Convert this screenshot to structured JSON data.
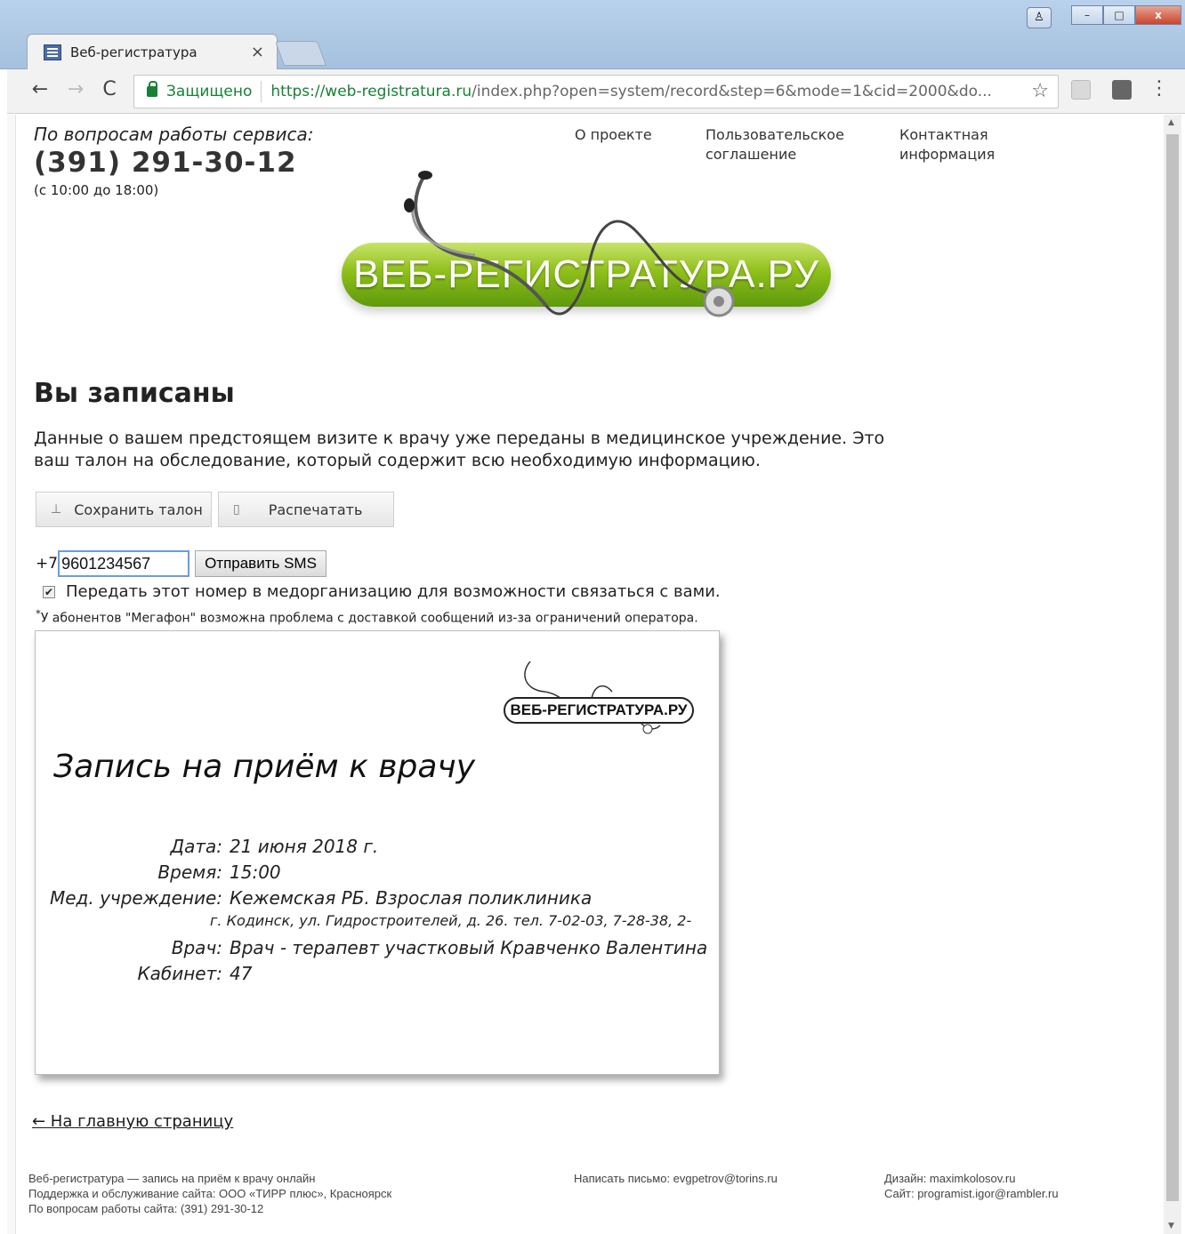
{
  "browser": {
    "tab_title": "Веб-регистратура",
    "tab_close": "×",
    "secure_label": "Защищено",
    "url_scheme_host": "https://web-registratura.ru",
    "url_rest": "/index.php?open=system/record&step=6&mode=1&cid=2000&do...",
    "back": "←",
    "forward": "→",
    "reload": "C",
    "star": "☆",
    "menu": "⋮",
    "win_min": "–",
    "win_max": "□",
    "win_close": "x",
    "user": "♙"
  },
  "support": {
    "label": "По вопросам работы сервиса:",
    "phone": "(391) 291-30-12",
    "hours": "(с 10:00 до 18:00)"
  },
  "nav": [
    {
      "label": "О проекте"
    },
    {
      "label": "Пользовательское соглашение"
    },
    {
      "label": "Контактная информация"
    }
  ],
  "logo_text": "ВЕБ-РЕГИСТРАТУРА.РУ",
  "heading": "Вы записаны",
  "lead": "Данные о вашем предстоящем визите к врачу уже переданы в медицинское учреждение. Это ваш талон на обследование, который содержит всю необходимую информацию.",
  "buttons": {
    "save": "Сохранить талон",
    "save_icon": "⊥",
    "print": "Распечатать",
    "print_icon": "▯"
  },
  "sms": {
    "prefix": "+7",
    "phone_value": "9601234567",
    "send_label": "Отправить SMS",
    "consent_label": "Передать этот номер в медорганизацию для возможности связаться с вами.",
    "consent_checked": true,
    "note_mark": "*",
    "note": "У абонентов \"Мегафон\" возможна проблема с доставкой сообщений из-за ограничений оператора."
  },
  "ticket": {
    "logo_text": "ВЕБ-РЕГИСТРАТУРА.РУ",
    "title": "Запись на приём к врачу",
    "rows": [
      {
        "label": "Дата:",
        "value": "21 июня 2018 г."
      },
      {
        "label": "Время:",
        "value": "15:00"
      },
      {
        "label": "Мед. учреждение:",
        "value": "Кежемская РБ. Взрослая поликлиника"
      },
      {
        "label": "Врач:",
        "value": "Врач - терапевт  участковый Кравченко Валентина"
      },
      {
        "label": "Кабинет:",
        "value": "47"
      }
    ],
    "address": "г. Кодинск, ул. Гидростроителей, д. 26. тел. 7-02-03, 7-28-38, 2-"
  },
  "back_link": "← На главную страницу",
  "footer": {
    "col1": [
      "Веб-регистратура — запись на приём к врачу онлайн",
      "Поддержка и обслуживание сайта: ООО «ТИРР плюс», Красноярск",
      "По вопросам работы сайта: (391) 291-30-12"
    ],
    "col2": [
      "Написать письмо: evgpetrov@torins.ru"
    ],
    "col3": [
      "Дизайн: maximkolosov.ru",
      "Сайт: programist.igor@rambler.ru"
    ]
  },
  "colors": {
    "accent_green": "#8fbf1a",
    "secure_green": "#188038",
    "input_focus": "#6d9be0"
  }
}
